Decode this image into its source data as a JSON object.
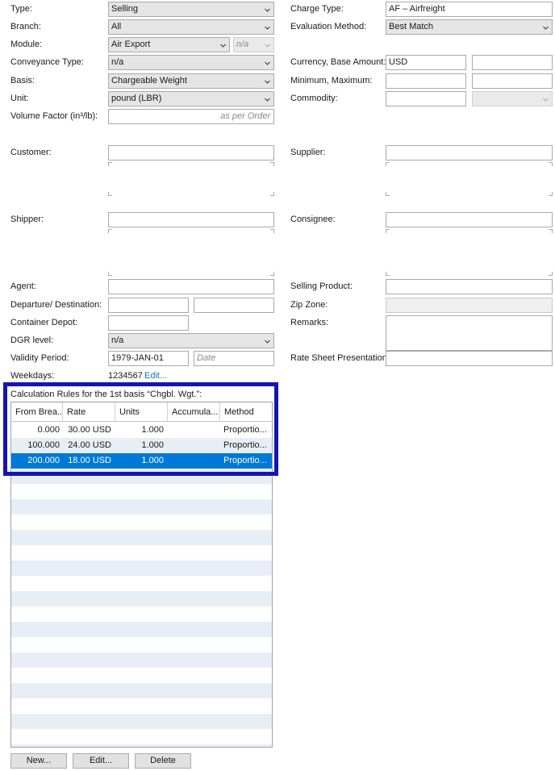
{
  "left_form": {
    "type": {
      "label": "Type:",
      "value": "Selling"
    },
    "branch": {
      "label": "Branch:",
      "value": "All"
    },
    "module": {
      "label": "Module:",
      "value": "Air Export",
      "sub_value": "n/a"
    },
    "conveyance": {
      "label": "Conveyance Type:",
      "value": "n/a"
    },
    "basis": {
      "label": "Basis:",
      "value": "Chargeable Weight"
    },
    "unit": {
      "label": "Unit:",
      "value": "pound (LBR)"
    },
    "volume_factor": {
      "label": "Volume Factor (in³/lb):",
      "placeholder": "as per Order"
    },
    "customer": {
      "label": "Customer:"
    },
    "shipper": {
      "label": "Shipper:"
    },
    "agent": {
      "label": "Agent:"
    },
    "departure": {
      "label": "Departure/ Destination:"
    },
    "container_depot": {
      "label": "Container Depot:"
    },
    "dgr_level": {
      "label": "DGR level:",
      "value": "n/a"
    },
    "validity": {
      "label": "Validity Period:",
      "from": "1979-JAN-01",
      "to_placeholder": "Date"
    },
    "weekdays": {
      "label": "Weekdays:",
      "value": "1234567",
      "edit_link": "Edit..."
    }
  },
  "right_form": {
    "charge_type": {
      "label": "Charge Type:",
      "value": "AF – Airfreight"
    },
    "evaluation": {
      "label": "Evaluation Method:",
      "value": "Best Match"
    },
    "currency": {
      "label": "Currency, Base Amount:",
      "value": "USD"
    },
    "minmax": {
      "label": "Minimum, Maximum:"
    },
    "commodity": {
      "label": "Commodity:"
    },
    "supplier": {
      "label": "Supplier:"
    },
    "consignee": {
      "label": "Consignee:"
    },
    "selling_product": {
      "label": "Selling Product:"
    },
    "zip_zone": {
      "label": "Zip Zone:"
    },
    "remarks": {
      "label": "Remarks:"
    },
    "rate_sheet": {
      "label": "Rate Sheet Presentation:"
    }
  },
  "calc_rules": {
    "title": "Calculation Rules for the 1st basis “Chgbl. Wgt.”:",
    "columns": [
      "From Brea...",
      "Rate",
      "Units",
      "Accumula...",
      "Method"
    ],
    "rows": [
      {
        "from": "0.000",
        "rate": "30.00 USD",
        "units": "1.000",
        "accum": "",
        "method": "Proportio...",
        "selected": false
      },
      {
        "from": "100.000",
        "rate": "24.00 USD",
        "units": "1.000",
        "accum": "",
        "method": "Proportio...",
        "selected": false
      },
      {
        "from": "200.000",
        "rate": "18.00 USD",
        "units": "1.000",
        "accum": "",
        "method": "Proportio...",
        "selected": true
      }
    ]
  },
  "buttons": {
    "new": "New...",
    "edit": "Edit...",
    "delete": "Delete"
  },
  "colors": {
    "selection": "#0078d7",
    "highlight_border": "#1414b4",
    "stripe": "#e8eef6",
    "link": "#1e6fc9"
  }
}
